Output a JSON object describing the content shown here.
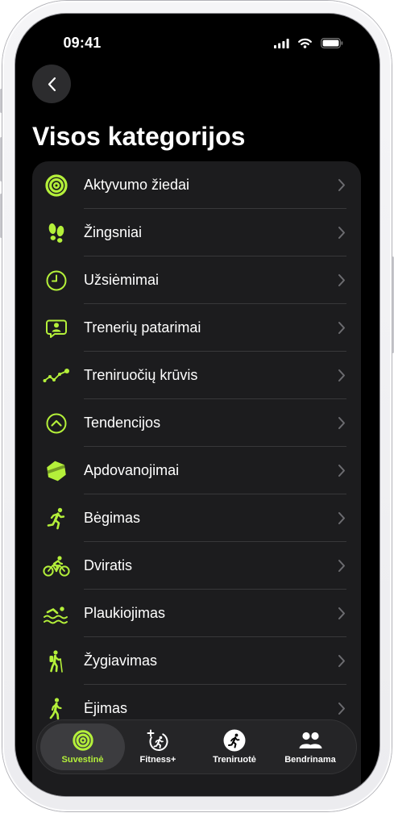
{
  "colors": {
    "accent": "#b4f03a",
    "screen_background": "#000000",
    "card_background": "#1c1c1e",
    "separator": "#38383a",
    "chevron": "#6c6c70",
    "selected_tab_background": "#3c3c3f",
    "back_button_background": "#2c2c2e"
  },
  "status_bar": {
    "time": "09:41",
    "icons": [
      "cellular-signal-icon",
      "wifi-icon",
      "battery-icon"
    ]
  },
  "navigation": {
    "back_icon": "chevron-left-icon"
  },
  "title": "Visos kategorijos",
  "categories": [
    {
      "label": "Aktyvumo žiedai",
      "icon": "activity-rings-icon"
    },
    {
      "label": "Žingsniai",
      "icon": "footprints-icon"
    },
    {
      "label": "Užsiėmimai",
      "icon": "clock-icon"
    },
    {
      "label": "Trenerių patarimai",
      "icon": "coaching-tips-icon"
    },
    {
      "label": "Treniruočių krūvis",
      "icon": "training-load-icon"
    },
    {
      "label": "Tendencijos",
      "icon": "trends-icon"
    },
    {
      "label": "Apdovanojimai",
      "icon": "awards-icon"
    },
    {
      "label": "Bėgimas",
      "icon": "running-icon"
    },
    {
      "label": "Dviratis",
      "icon": "cycling-icon"
    },
    {
      "label": "Plaukiojimas",
      "icon": "swimming-icon"
    },
    {
      "label": "Žygiavimas",
      "icon": "hiking-icon"
    },
    {
      "label": "Ėjimas",
      "icon": "walking-icon"
    }
  ],
  "row_accessory_icon": "chevron-right-icon",
  "tab_bar": {
    "tabs": [
      {
        "label": "Suvestinė",
        "icon": "summary-rings-icon",
        "selected": true
      },
      {
        "label": "Fitness+",
        "icon": "fitness-plus-icon",
        "selected": false
      },
      {
        "label": "Treniruotė",
        "icon": "workout-icon",
        "selected": false
      },
      {
        "label": "Bendrinama",
        "icon": "sharing-icon",
        "selected": false
      }
    ]
  }
}
